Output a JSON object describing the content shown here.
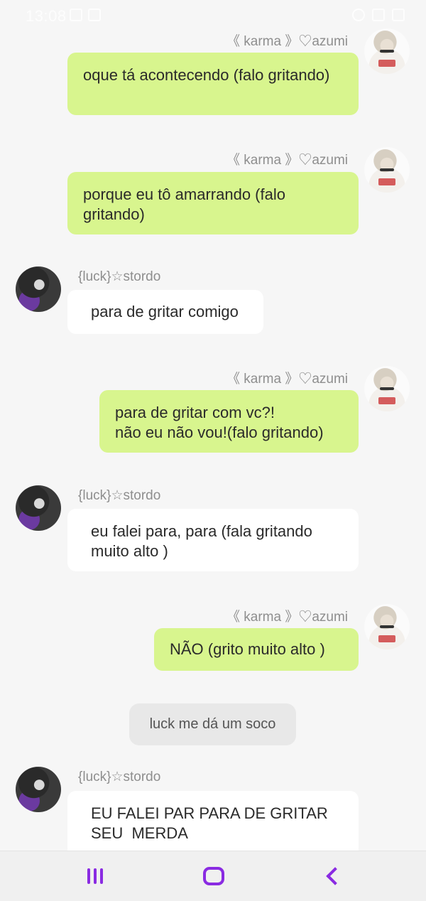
{
  "status_bar": {
    "time": "13:08"
  },
  "messages": [
    {
      "author": "《 karma 》♡azumi",
      "text": "oque tá acontecendo (falo gritando)",
      "side": "me"
    },
    {
      "author": "《 karma 》♡azumi",
      "text": "porque eu tô amarrando (falo gritando)",
      "side": "me"
    },
    {
      "author": "{luck}☆stordo",
      "text": "para de gritar comigo",
      "side": "them"
    },
    {
      "author": "《 karma 》♡azumi",
      "text": "para de gritar com vc?!\nnão eu não vou!(falo gritando)",
      "side": "me"
    },
    {
      "author": "{luck}☆stordo",
      "text": "eu falei para, para (fala gritando muito alto )",
      "side": "them"
    },
    {
      "author": "《 karma 》♡azumi",
      "text": "NÃO (grito muito alto )",
      "side": "me"
    },
    {
      "author": "{luck}☆stordo",
      "text": "EU FALEI PAR PARA DE GRITAR SEU  MERDA",
      "side": "them"
    }
  ],
  "system_message": "luck me dá um soco",
  "colors": {
    "my_bubble": "#d8f58e",
    "their_bubble": "#ffffff",
    "nav_accent": "#8a2be2",
    "background": "#f6f6f6"
  },
  "nav": {
    "recents": "recents-icon",
    "home": "home-icon",
    "back": "back-icon"
  }
}
